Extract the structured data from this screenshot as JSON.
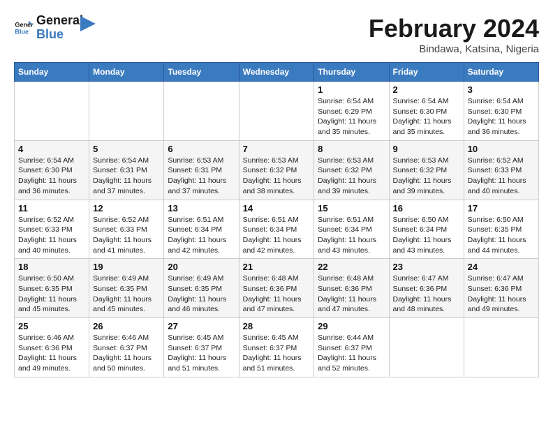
{
  "header": {
    "logo_general": "General",
    "logo_blue": "Blue",
    "month_title": "February 2024",
    "subtitle": "Bindawa, Katsina, Nigeria"
  },
  "weekdays": [
    "Sunday",
    "Monday",
    "Tuesday",
    "Wednesday",
    "Thursday",
    "Friday",
    "Saturday"
  ],
  "weeks": [
    [
      {
        "day": "",
        "info": ""
      },
      {
        "day": "",
        "info": ""
      },
      {
        "day": "",
        "info": ""
      },
      {
        "day": "",
        "info": ""
      },
      {
        "day": "1",
        "info": "Sunrise: 6:54 AM\nSunset: 6:29 PM\nDaylight: 11 hours\nand 35 minutes."
      },
      {
        "day": "2",
        "info": "Sunrise: 6:54 AM\nSunset: 6:30 PM\nDaylight: 11 hours\nand 35 minutes."
      },
      {
        "day": "3",
        "info": "Sunrise: 6:54 AM\nSunset: 6:30 PM\nDaylight: 11 hours\nand 36 minutes."
      }
    ],
    [
      {
        "day": "4",
        "info": "Sunrise: 6:54 AM\nSunset: 6:30 PM\nDaylight: 11 hours\nand 36 minutes."
      },
      {
        "day": "5",
        "info": "Sunrise: 6:54 AM\nSunset: 6:31 PM\nDaylight: 11 hours\nand 37 minutes."
      },
      {
        "day": "6",
        "info": "Sunrise: 6:53 AM\nSunset: 6:31 PM\nDaylight: 11 hours\nand 37 minutes."
      },
      {
        "day": "7",
        "info": "Sunrise: 6:53 AM\nSunset: 6:32 PM\nDaylight: 11 hours\nand 38 minutes."
      },
      {
        "day": "8",
        "info": "Sunrise: 6:53 AM\nSunset: 6:32 PM\nDaylight: 11 hours\nand 39 minutes."
      },
      {
        "day": "9",
        "info": "Sunrise: 6:53 AM\nSunset: 6:32 PM\nDaylight: 11 hours\nand 39 minutes."
      },
      {
        "day": "10",
        "info": "Sunrise: 6:52 AM\nSunset: 6:33 PM\nDaylight: 11 hours\nand 40 minutes."
      }
    ],
    [
      {
        "day": "11",
        "info": "Sunrise: 6:52 AM\nSunset: 6:33 PM\nDaylight: 11 hours\nand 40 minutes."
      },
      {
        "day": "12",
        "info": "Sunrise: 6:52 AM\nSunset: 6:33 PM\nDaylight: 11 hours\nand 41 minutes."
      },
      {
        "day": "13",
        "info": "Sunrise: 6:51 AM\nSunset: 6:34 PM\nDaylight: 11 hours\nand 42 minutes."
      },
      {
        "day": "14",
        "info": "Sunrise: 6:51 AM\nSunset: 6:34 PM\nDaylight: 11 hours\nand 42 minutes."
      },
      {
        "day": "15",
        "info": "Sunrise: 6:51 AM\nSunset: 6:34 PM\nDaylight: 11 hours\nand 43 minutes."
      },
      {
        "day": "16",
        "info": "Sunrise: 6:50 AM\nSunset: 6:34 PM\nDaylight: 11 hours\nand 43 minutes."
      },
      {
        "day": "17",
        "info": "Sunrise: 6:50 AM\nSunset: 6:35 PM\nDaylight: 11 hours\nand 44 minutes."
      }
    ],
    [
      {
        "day": "18",
        "info": "Sunrise: 6:50 AM\nSunset: 6:35 PM\nDaylight: 11 hours\nand 45 minutes."
      },
      {
        "day": "19",
        "info": "Sunrise: 6:49 AM\nSunset: 6:35 PM\nDaylight: 11 hours\nand 45 minutes."
      },
      {
        "day": "20",
        "info": "Sunrise: 6:49 AM\nSunset: 6:35 PM\nDaylight: 11 hours\nand 46 minutes."
      },
      {
        "day": "21",
        "info": "Sunrise: 6:48 AM\nSunset: 6:36 PM\nDaylight: 11 hours\nand 47 minutes."
      },
      {
        "day": "22",
        "info": "Sunrise: 6:48 AM\nSunset: 6:36 PM\nDaylight: 11 hours\nand 47 minutes."
      },
      {
        "day": "23",
        "info": "Sunrise: 6:47 AM\nSunset: 6:36 PM\nDaylight: 11 hours\nand 48 minutes."
      },
      {
        "day": "24",
        "info": "Sunrise: 6:47 AM\nSunset: 6:36 PM\nDaylight: 11 hours\nand 49 minutes."
      }
    ],
    [
      {
        "day": "25",
        "info": "Sunrise: 6:46 AM\nSunset: 6:36 PM\nDaylight: 11 hours\nand 49 minutes."
      },
      {
        "day": "26",
        "info": "Sunrise: 6:46 AM\nSunset: 6:37 PM\nDaylight: 11 hours\nand 50 minutes."
      },
      {
        "day": "27",
        "info": "Sunrise: 6:45 AM\nSunset: 6:37 PM\nDaylight: 11 hours\nand 51 minutes."
      },
      {
        "day": "28",
        "info": "Sunrise: 6:45 AM\nSunset: 6:37 PM\nDaylight: 11 hours\nand 51 minutes."
      },
      {
        "day": "29",
        "info": "Sunrise: 6:44 AM\nSunset: 6:37 PM\nDaylight: 11 hours\nand 52 minutes."
      },
      {
        "day": "",
        "info": ""
      },
      {
        "day": "",
        "info": ""
      }
    ]
  ]
}
